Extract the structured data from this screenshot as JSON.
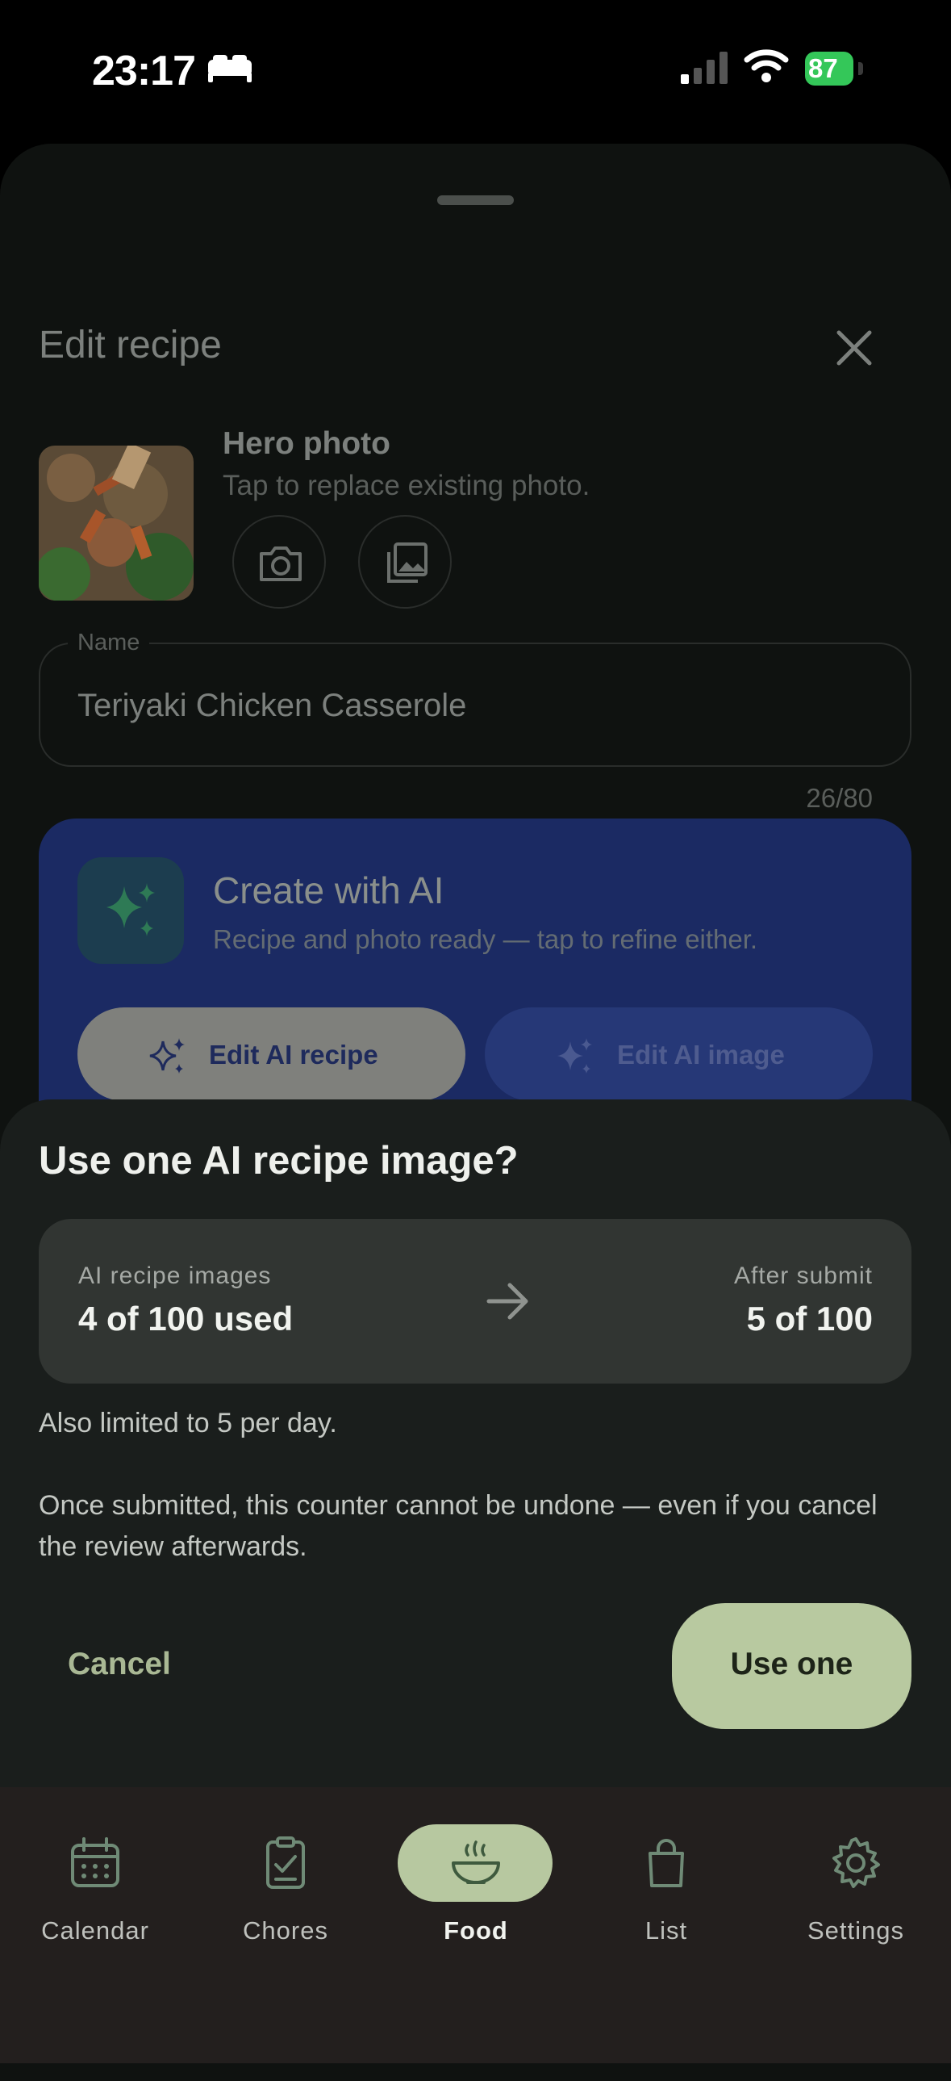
{
  "status_bar": {
    "time": "23:17",
    "battery": "87"
  },
  "sheet": {
    "title": "Edit recipe",
    "hero": {
      "title": "Hero photo",
      "subtitle": "Tap to replace existing photo."
    },
    "name_field": {
      "label": "Name",
      "value": "Teriyaki Chicken Casserole",
      "counter": "26/80"
    },
    "ai_card": {
      "title": "Create with AI",
      "subtitle": "Recipe and photo ready — tap to refine either.",
      "edit_recipe_label": "Edit AI recipe",
      "edit_image_label": "Edit AI image"
    }
  },
  "dialog": {
    "title": "Use one AI recipe image?",
    "usage": {
      "current_label": "AI recipe images",
      "current_value": "4 of 100 used",
      "after_label": "After submit",
      "after_value": "5 of 100"
    },
    "note_daily": "Also limited to 5 per day.",
    "note_undo": "Once submitted, this counter cannot be undone — even if you cancel the review afterwards.",
    "cancel_label": "Cancel",
    "confirm_label": "Use one"
  },
  "nav": {
    "items": [
      {
        "label": "Calendar",
        "icon": "calendar-icon",
        "active": false
      },
      {
        "label": "Chores",
        "icon": "clipboard-check-icon",
        "active": false
      },
      {
        "label": "Food",
        "icon": "bowl-icon",
        "active": true
      },
      {
        "label": "List",
        "icon": "shopping-bag-icon",
        "active": false
      },
      {
        "label": "Settings",
        "icon": "gear-icon",
        "active": false
      }
    ]
  },
  "colors": {
    "accent": "#b8c9a0",
    "ai_card": "#1b2a63",
    "dialog_bg": "#1a1e1c",
    "battery": "#34c759"
  }
}
